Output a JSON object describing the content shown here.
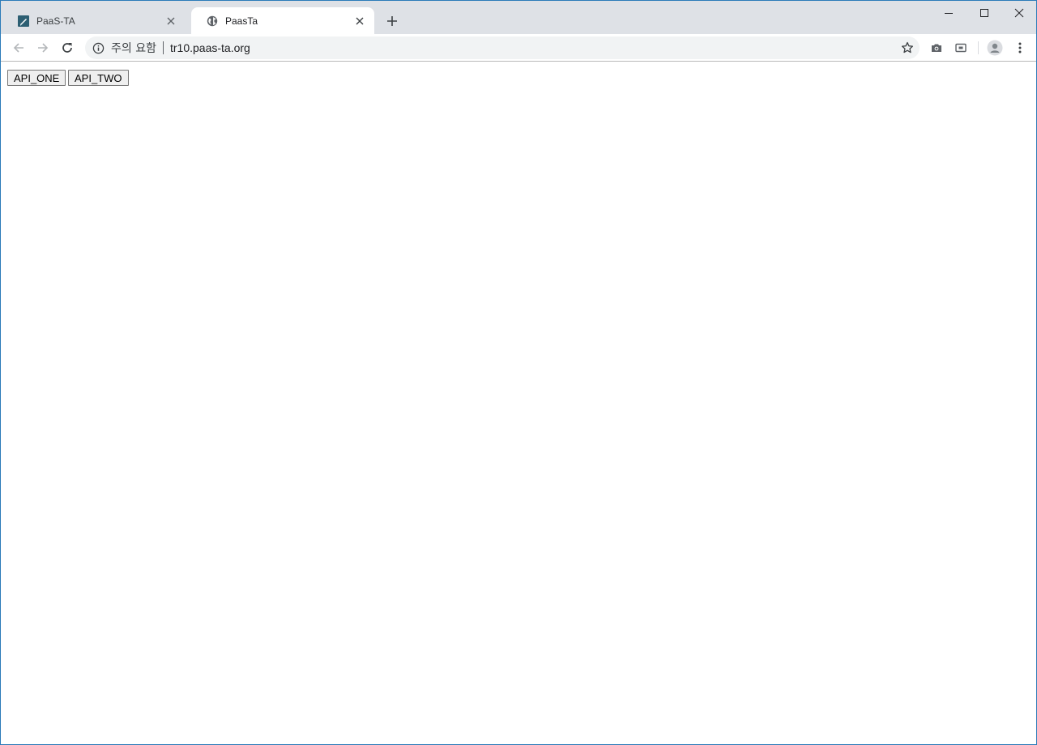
{
  "browser": {
    "tabs": [
      {
        "title": "PaaS-TA",
        "favicon": "paas-ta-logo-icon",
        "active": false
      },
      {
        "title": "PaasTa",
        "favicon": "globe-icon",
        "active": true
      }
    ],
    "omnibox": {
      "security_label": "주의 요함",
      "url": "tr10.paas-ta.org"
    },
    "colors": {
      "tabstrip": "#dee1e6",
      "frame_border": "#2b7bb9",
      "icon": "#5f6368"
    }
  },
  "page": {
    "buttons": [
      {
        "label": "API_ONE"
      },
      {
        "label": "API_TWO"
      }
    ]
  }
}
